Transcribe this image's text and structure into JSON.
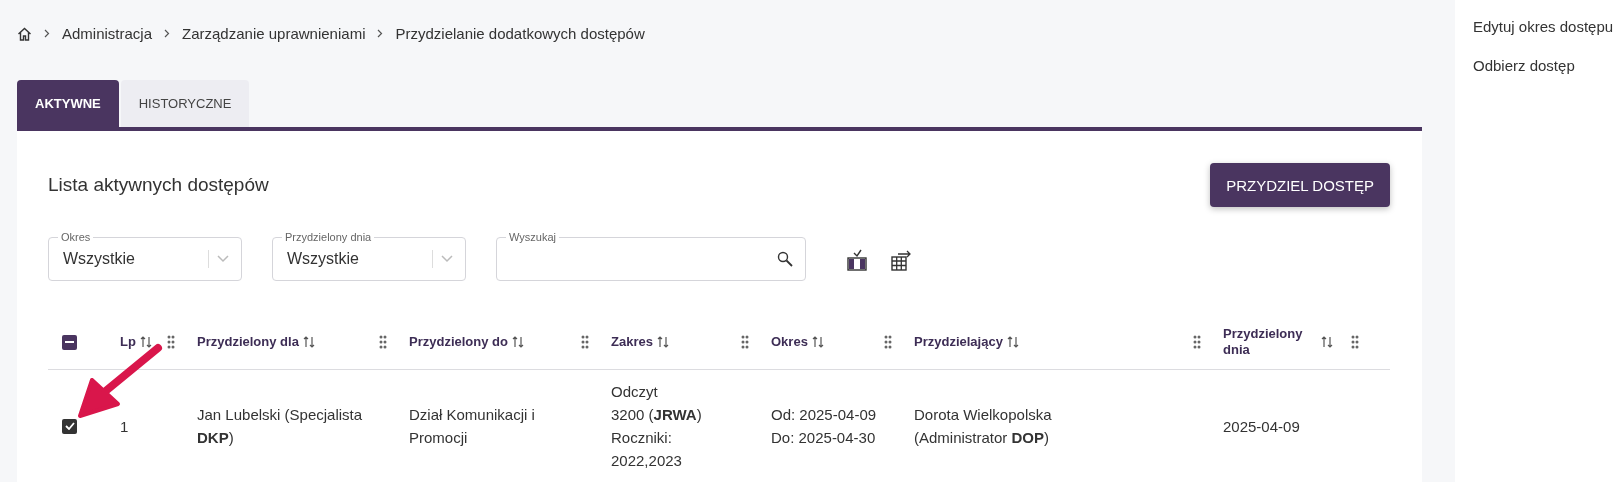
{
  "breadcrumb": [
    "Administracja",
    "Zarządzanie uprawnieniami",
    "Przydzielanie dodatkowych dostępów"
  ],
  "tabs": [
    {
      "label": "AKTYWNE",
      "selected": true
    },
    {
      "label": "HISTORYCZNE",
      "selected": false
    }
  ],
  "list_title": "Lista aktywnych dostępów",
  "primary_button": "PRZYDZIEL DOSTĘP",
  "filters": [
    {
      "kind": "select",
      "label": "Okres",
      "value": "Wszystkie"
    },
    {
      "kind": "select",
      "label": "Przydzielony dnia",
      "value": "Wszystkie"
    },
    {
      "kind": "search",
      "label": "Wyszukaj"
    }
  ],
  "table": {
    "select_all": {
      "partial": true
    },
    "columns": [
      {
        "label": "Lp"
      },
      {
        "label": "Przydzielony dla"
      },
      {
        "label": "Przydzielony do"
      },
      {
        "label": "Zakres"
      },
      {
        "label": "Okres"
      },
      {
        "label": "Przydzielający"
      },
      {
        "label": "Przydzielony dnia"
      }
    ],
    "rows": [
      {
        "selected": true,
        "cells": [
          [
            "1"
          ],
          [
            "Jan Lubelski (Specjalista",
            "**DKP**)"
          ],
          [
            "Dział Komunikacji i",
            "Promocji"
          ],
          [
            "Odczyt",
            "3200 (**JRWA**)",
            "Roczniki:",
            "2022,2023"
          ],
          [
            "Od: 2025-04-09",
            "Do: 2025-04-30"
          ],
          [
            "Dorota Wielkopolska",
            "(Administrator **DOP**)"
          ],
          [
            "2025-04-09"
          ]
        ]
      }
    ]
  },
  "annotations": [
    {
      "kind": "arrow"
    }
  ],
  "side_menu": [
    "Edytuj okres dostępu",
    "Odbierz dostęp"
  ]
}
